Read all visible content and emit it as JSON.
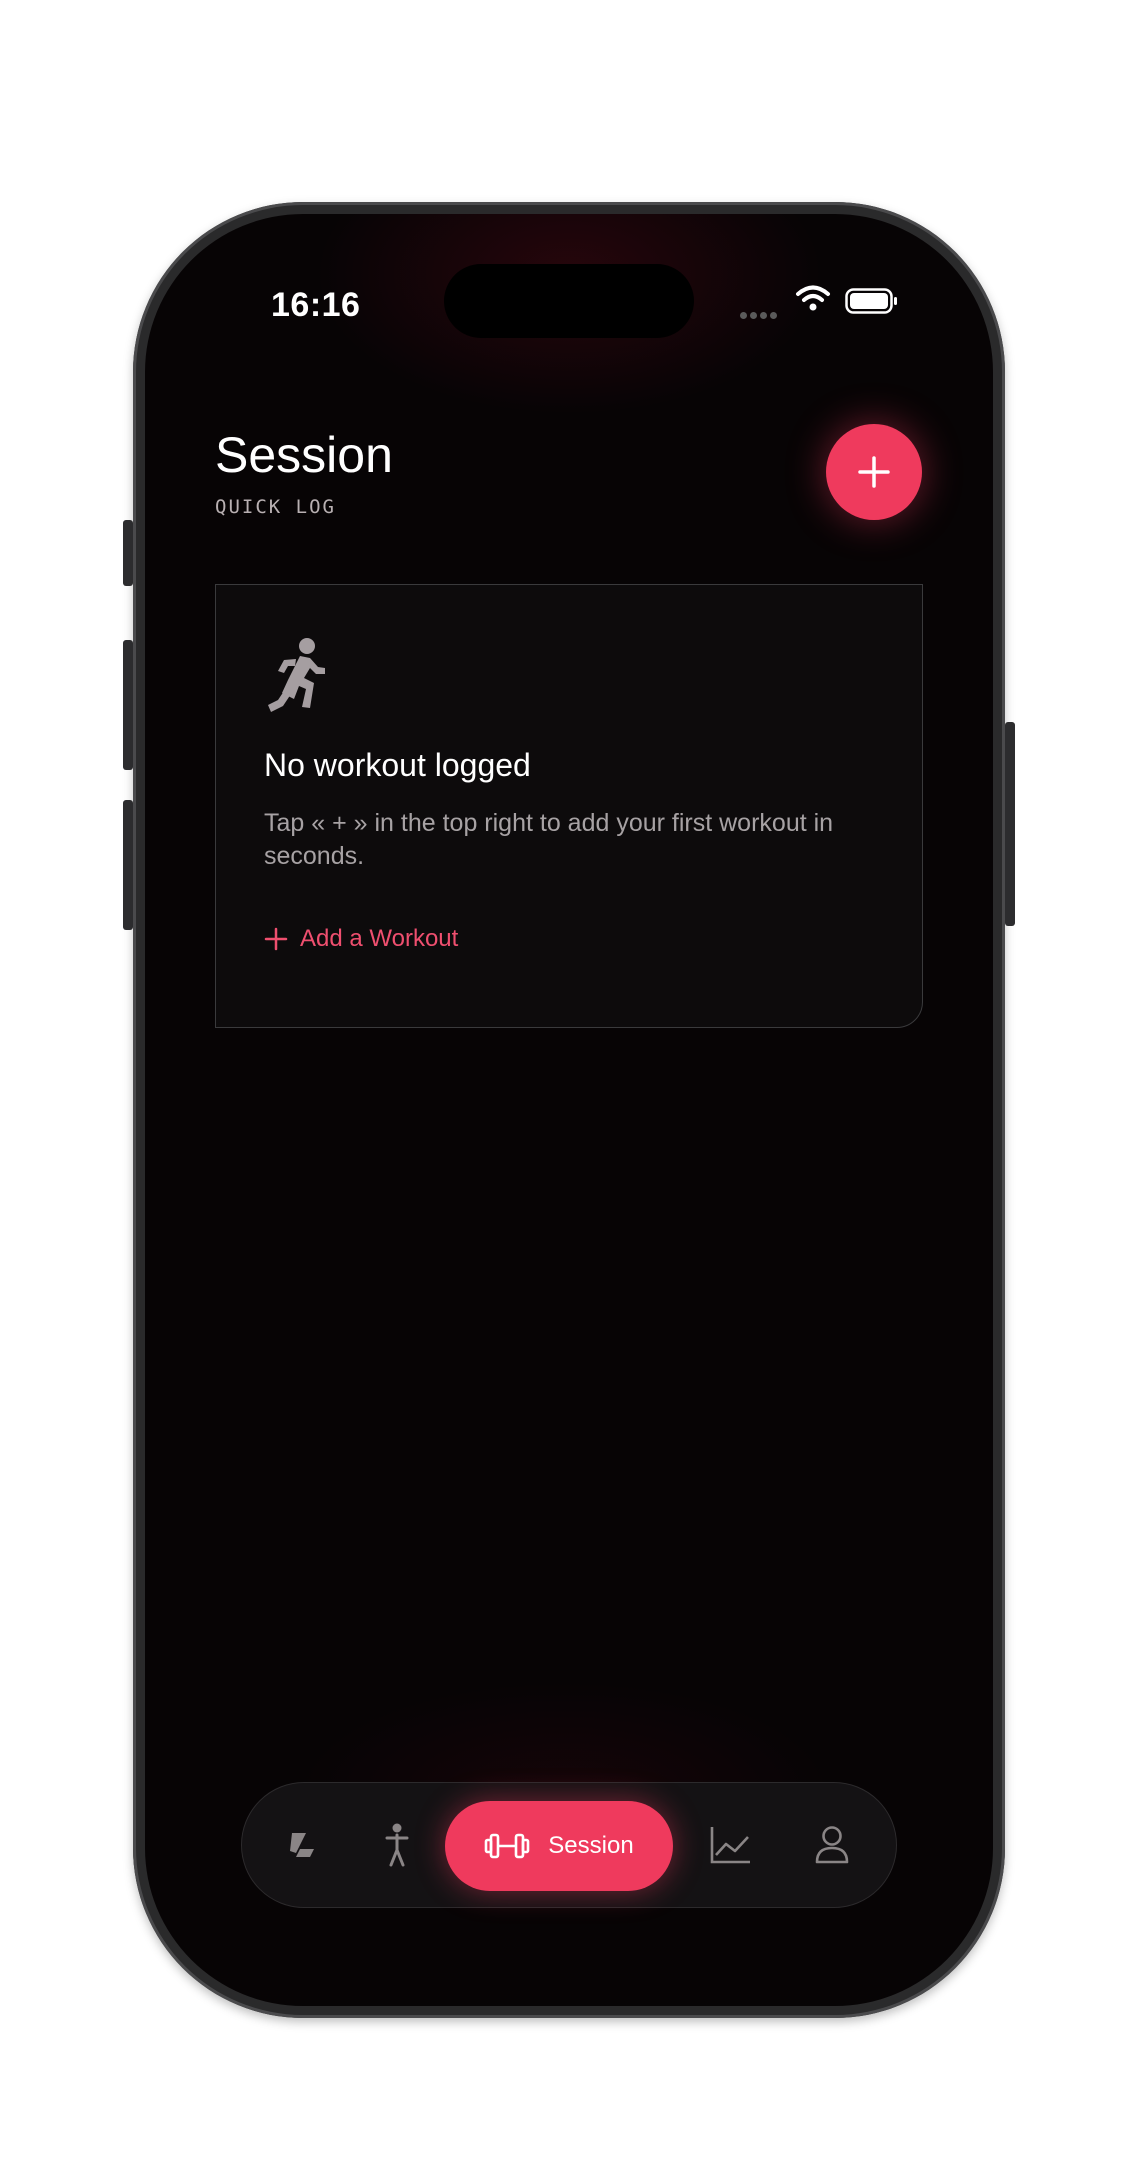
{
  "status_bar": {
    "time": "16:16"
  },
  "header": {
    "title": "Session",
    "subtitle": "QUICK LOG",
    "add_button_icon": "plus-icon"
  },
  "empty_state": {
    "icon": "running-figure-icon",
    "title": "No workout logged",
    "description": "Tap « + » in the top right to add your first workout in seconds.",
    "action_label": "Add a Workout"
  },
  "tab_bar": {
    "items": [
      {
        "icon": "logo-icon",
        "label": ""
      },
      {
        "icon": "person-standing-icon",
        "label": ""
      },
      {
        "icon": "dumbbell-icon",
        "label": "Session",
        "active": true
      },
      {
        "icon": "chart-line-icon",
        "label": ""
      },
      {
        "icon": "profile-icon",
        "label": ""
      }
    ]
  },
  "colors": {
    "accent": "#ef3a5d",
    "background": "#070405",
    "card": "#0d0b0c",
    "text_secondary": "#a7a2a4"
  }
}
